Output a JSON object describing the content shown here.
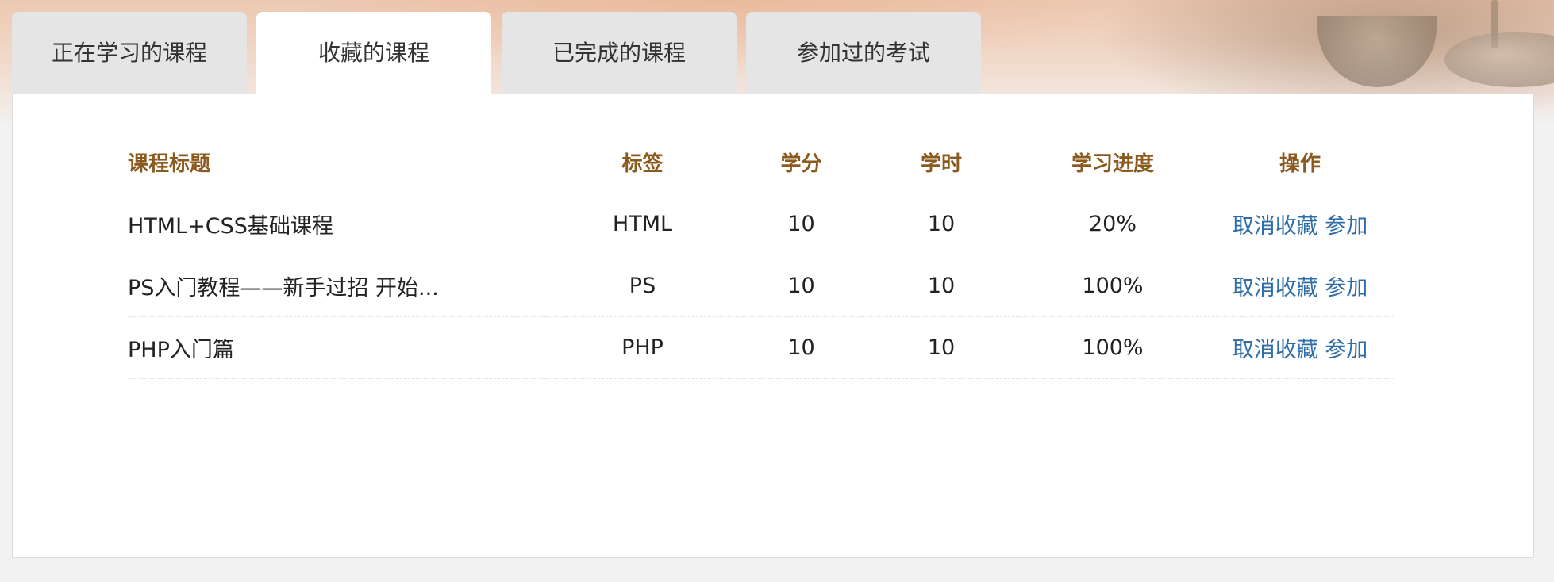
{
  "tabs": [
    {
      "label": "正在学习的课程",
      "active": false
    },
    {
      "label": "收藏的课程",
      "active": true
    },
    {
      "label": "已完成的课程",
      "active": false
    },
    {
      "label": "参加过的考试",
      "active": false
    }
  ],
  "table": {
    "headers": [
      "课程标题",
      "标签",
      "学分",
      "学时",
      "学习进度",
      "操作"
    ],
    "rows": [
      {
        "title": "HTML+CSS基础课程",
        "tag": "HTML",
        "credit": "10",
        "hours": "10",
        "progress": "20%",
        "cancel": "取消收藏",
        "join": "参加"
      },
      {
        "title": "PS入门教程——新手过招 开始...",
        "tag": "PS",
        "credit": "10",
        "hours": "10",
        "progress": "100%",
        "cancel": "取消收藏",
        "join": "参加"
      },
      {
        "title": "PHP入门篇",
        "tag": "PHP",
        "credit": "10",
        "hours": "10",
        "progress": "100%",
        "cancel": "取消收藏",
        "join": "参加"
      }
    ]
  },
  "colors": {
    "header_text": "#8b5a1e",
    "link": "#2f6da8",
    "tab_inactive": "#e5e5e5",
    "tab_active": "#ffffff"
  }
}
